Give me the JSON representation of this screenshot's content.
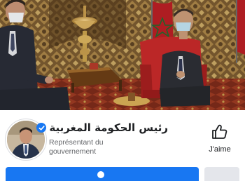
{
  "cover": {
    "image": "Photo of two men seated in a formal Moroccan palace salon with flags"
  },
  "page": {
    "name": "رئيس الحكومة المغربية",
    "verified": true,
    "category": "Représentant du gouvernement"
  },
  "actions": {
    "like_label": "J'aime",
    "primary_label": "",
    "secondary_label": ""
  },
  "colors": {
    "accent": "#1877f2",
    "secondary_button": "#e4e6eb",
    "muted_text": "#65676b"
  },
  "icons": {
    "verified": "verified-badge-icon",
    "like": "thumbs-up-icon"
  }
}
